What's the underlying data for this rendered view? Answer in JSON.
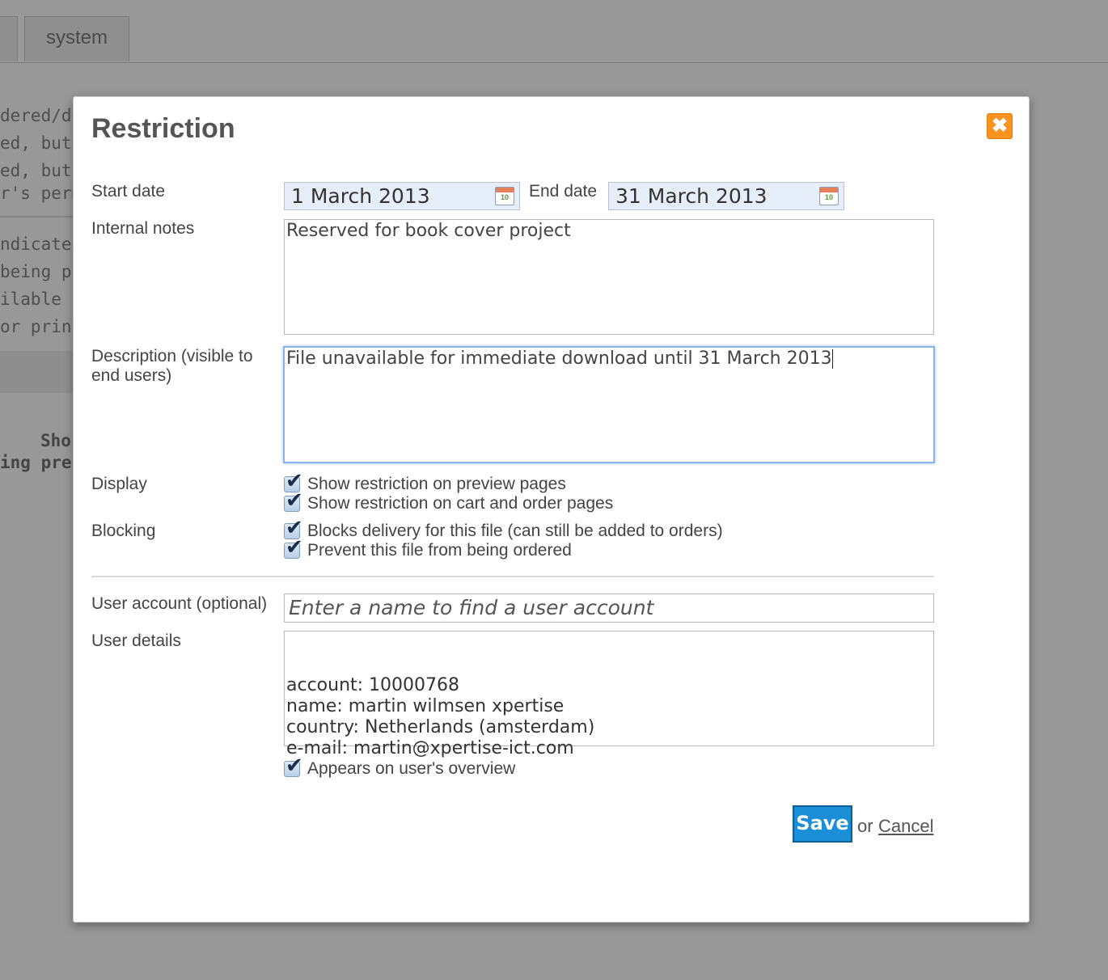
{
  "background": {
    "tabs": [
      "",
      "system"
    ],
    "lines": [
      "dered/de",
      "ed, but a",
      "ed, but c",
      "r's perm",
      "ndicated",
      " being p",
      "ilable to",
      "or print"
    ],
    "bold_lines": [
      "Sho",
      "ing pre"
    ]
  },
  "modal": {
    "title": "Restriction",
    "close_label": "✖",
    "start_date": {
      "label": "Start date",
      "value": "1 March 2013",
      "icon": "calendar-icon",
      "icon_day": "10"
    },
    "end_date": {
      "label": "End date",
      "value": "31 March 2013",
      "icon": "calendar-icon",
      "icon_day": "10"
    },
    "internal_notes": {
      "label": "Internal notes",
      "value": "Reserved for book cover project"
    },
    "description": {
      "label": "Description (visible to end users)",
      "value": "File unavailable for immediate download until 31 March 2013"
    },
    "display": {
      "label": "Display",
      "options": [
        {
          "label": "Show restriction on preview pages",
          "checked": true
        },
        {
          "label": "Show restriction on cart and order pages",
          "checked": true
        }
      ]
    },
    "blocking": {
      "label": "Blocking",
      "options": [
        {
          "label": "Blocks delivery for this file (can still be added to orders)",
          "checked": true
        },
        {
          "label": "Prevent this file from being ordered",
          "checked": true
        }
      ]
    },
    "user_account": {
      "label": "User account (optional)",
      "placeholder": "Enter a name to find a user account"
    },
    "user_details": {
      "label": "User details",
      "lines": [
        "account: 10000768",
        "name: martin wilmsen xpertise",
        "country: Netherlands (amsterdam)",
        "e-mail: martin@xpertise-ict.com"
      ]
    },
    "overview": {
      "label": "Appears on user's overview",
      "checked": true
    },
    "save_label": "Save",
    "or_label": "or",
    "cancel_label": "Cancel"
  },
  "colors": {
    "overlay": "#989898",
    "save": "#1a8ed6",
    "close": "#f7931e",
    "focus": "#8ab3e6"
  }
}
